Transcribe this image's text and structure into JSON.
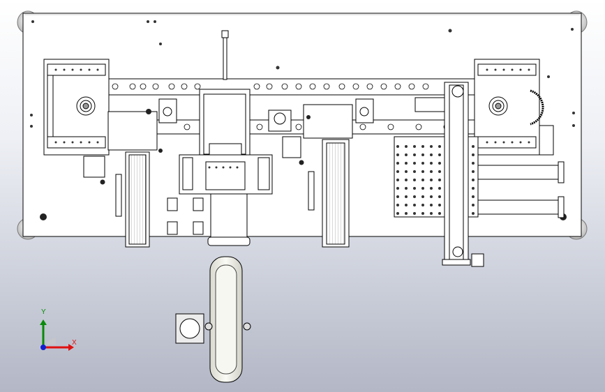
{
  "viewport": {
    "background_top": "#ffffff",
    "background_bottom": "#b3b7c6"
  },
  "model": {
    "line_color": "#000000",
    "plate_color": "#ffffff",
    "roller_color": "#f2f2f2"
  },
  "triad": {
    "x_label": "X",
    "y_label": "Y",
    "x_color": "#e01010",
    "y_color": "#0a8a0a",
    "z_color": "#1020d0"
  }
}
